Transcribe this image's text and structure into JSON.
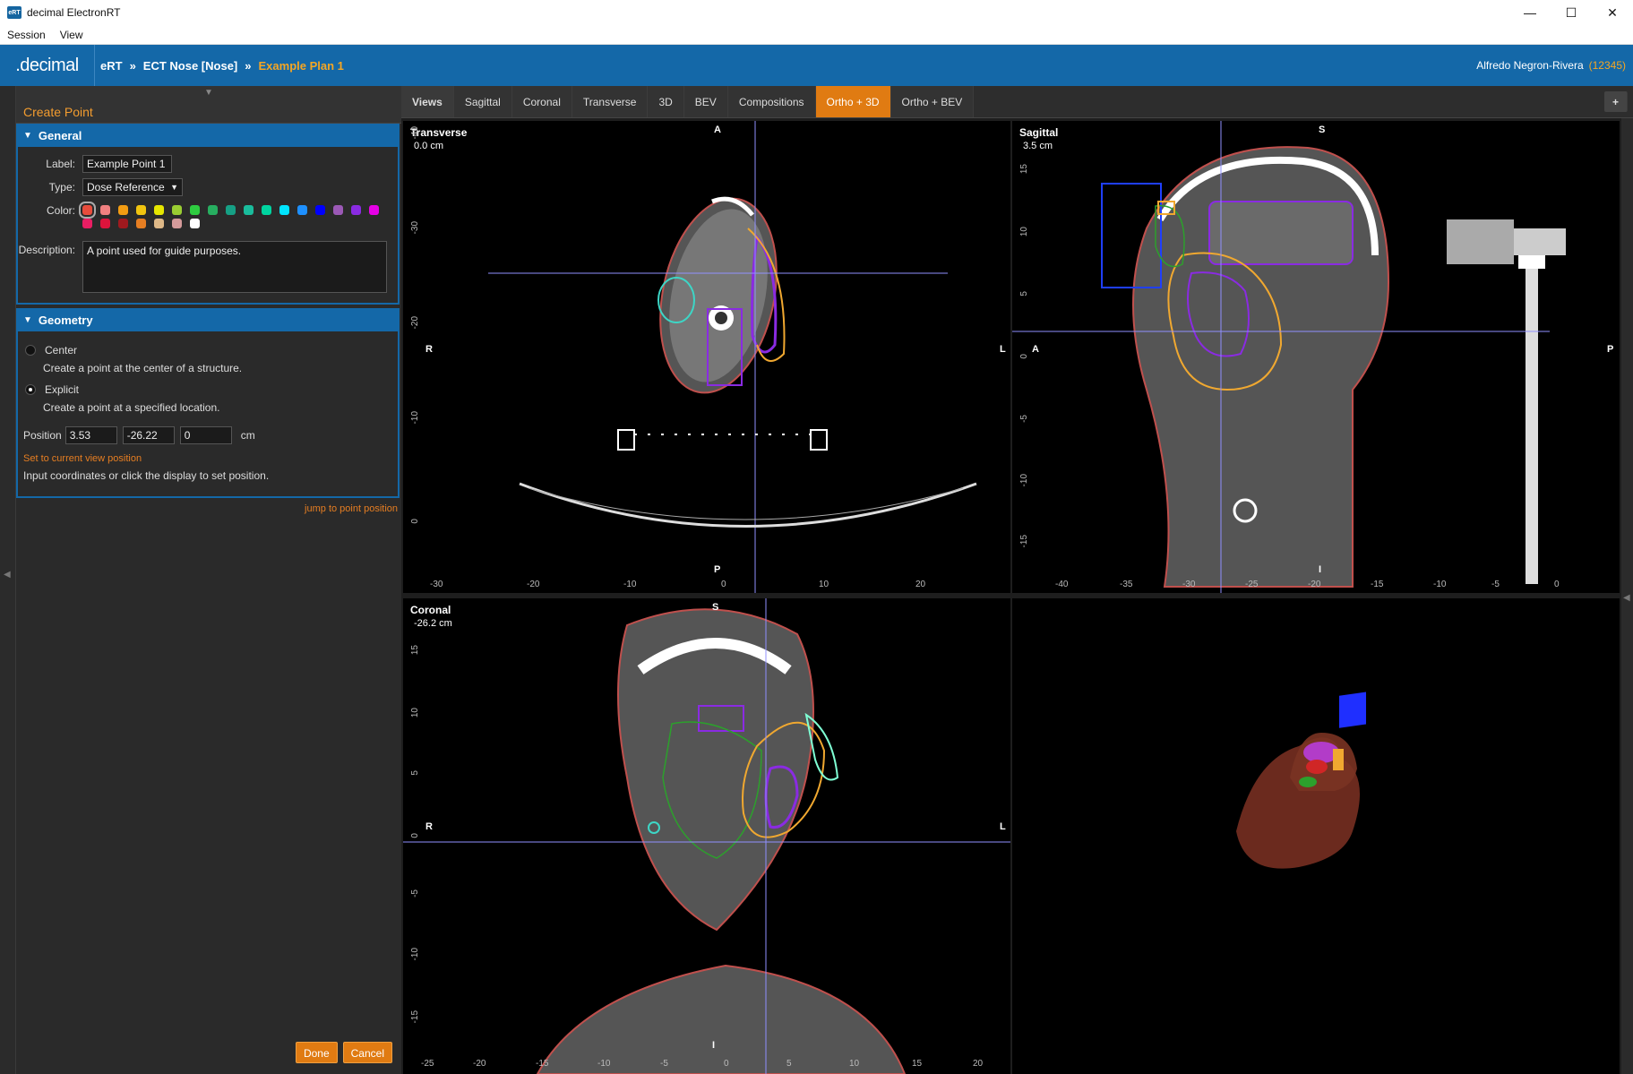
{
  "window": {
    "title": "decimal ElectronRT",
    "icon_text": "eRT",
    "minimize": "—",
    "maximize": "☐",
    "close": "✕"
  },
  "menu": [
    "Session",
    "View"
  ],
  "header": {
    "logo": ".decimal",
    "crumbs": [
      "eRT",
      "ECT Nose [Nose]",
      "Example Plan 1"
    ],
    "separator": "»",
    "user_name": "Alfredo Negron-Rivera",
    "user_id": "(12345)"
  },
  "panel": {
    "title": "Create Point",
    "general": {
      "heading": "General",
      "label_label": "Label:",
      "label_value": "Example Point 1",
      "type_label": "Type:",
      "type_value": "Dose Reference",
      "color_label": "Color:",
      "colors": [
        "#e74c3c",
        "#f08080",
        "#f39c12",
        "#f1c40f",
        "#e6e600",
        "#9acd32",
        "#2ecc40",
        "#27ae60",
        "#16a085",
        "#1abc9c",
        "#00d4a0",
        "#00e5ff",
        "#1e90ff",
        "#0000ff",
        "#9b59b6",
        "#8a2be2",
        "#e600e6",
        "#e91e63",
        "#dc143c",
        "#a0191e",
        "#e67e22",
        "#deb887",
        "#d49a9a",
        "#ffffff"
      ],
      "description_label": "Description:",
      "description_value": "A point used for guide purposes."
    },
    "geometry": {
      "heading": "Geometry",
      "center_label": "Center",
      "center_desc": "Create a point at the center of a structure.",
      "explicit_label": "Explicit",
      "explicit_desc": "Create a point at a specified location.",
      "selected": "Explicit",
      "position_label": "Position",
      "x": "3.53",
      "y": "-26.22",
      "z": "0",
      "unit": "cm",
      "set_current": "Set to current view position",
      "hint": "Input coordinates or click the display to set position."
    },
    "jump_link": "jump to point position",
    "done": "Done",
    "cancel": "Cancel"
  },
  "tabs": [
    "Views",
    "Sagittal",
    "Coronal",
    "Transverse",
    "3D",
    "BEV",
    "Compositions",
    "Ortho + 3D",
    "Ortho + BEV"
  ],
  "active_tab": "Ortho + 3D",
  "add_tab": "+",
  "views": {
    "transverse": {
      "name": "Transverse",
      "offset": "0.0 cm",
      "top": "A",
      "bottom": "P",
      "left": "R",
      "right": "L",
      "xticks": [
        "-30",
        "-20",
        "-10",
        "0",
        "10",
        "20"
      ],
      "yticks": [
        "-40",
        "-30",
        "-20",
        "-10",
        "0"
      ]
    },
    "sagittal": {
      "name": "Sagittal",
      "offset": "3.5 cm",
      "top": "S",
      "bottom": "I",
      "left": "A",
      "right": "P",
      "xticks": [
        "-40",
        "-35",
        "-30",
        "-25",
        "-20",
        "-15",
        "-10",
        "-5",
        "0"
      ],
      "yticks": [
        "15",
        "10",
        "5",
        "0",
        "-5",
        "-10",
        "-15"
      ]
    },
    "coronal": {
      "name": "Coronal",
      "offset": "-26.2 cm",
      "top": "S",
      "bottom": "I",
      "left": "R",
      "right": "L",
      "xticks": [
        "-25",
        "-20",
        "-15",
        "-10",
        "-5",
        "0",
        "5",
        "10",
        "15",
        "20"
      ],
      "yticks": [
        "15",
        "10",
        "5",
        "0",
        "-5",
        "-10",
        "-15"
      ]
    }
  }
}
